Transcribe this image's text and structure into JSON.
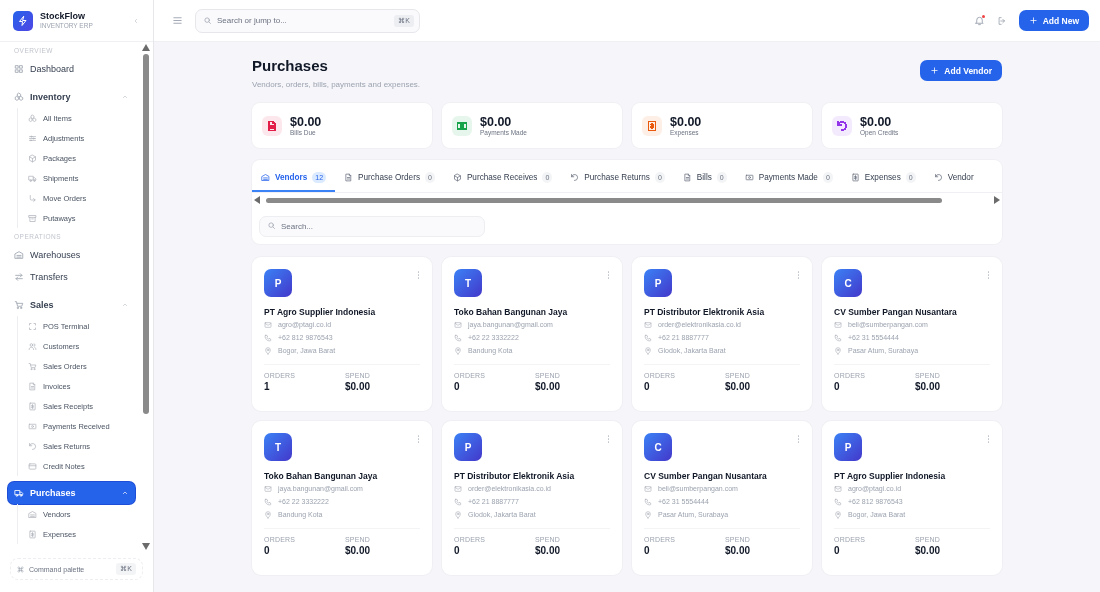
{
  "app": {
    "name": "StockFlow",
    "subtitle": "INVENTORY ERP"
  },
  "sidebar": {
    "sections": [
      {
        "label": "OVERVIEW",
        "items": [
          {
            "label": "Dashboard",
            "selected": false
          },
          {
            "label": "Inventory",
            "selected": false,
            "expanded": true,
            "children": [
              {
                "label": "All Items",
                "selected": false
              },
              {
                "label": "Adjustments",
                "selected": false
              },
              {
                "label": "Packages",
                "selected": false
              },
              {
                "label": "Shipments",
                "selected": false
              },
              {
                "label": "Move Orders",
                "selected": false
              },
              {
                "label": "Putaways",
                "selected": false
              }
            ]
          }
        ]
      },
      {
        "label": "OPERATIONS",
        "items": [
          {
            "label": "Warehouses",
            "selected": false
          },
          {
            "label": "Transfers",
            "selected": false
          },
          {
            "label": "Sales",
            "selected": false,
            "expanded": true,
            "children": [
              {
                "label": "POS Terminal",
                "selected": false
              },
              {
                "label": "Customers",
                "selected": false
              },
              {
                "label": "Sales Orders",
                "selected": false
              },
              {
                "label": "Invoices",
                "selected": false
              },
              {
                "label": "Sales Receipts",
                "selected": false
              },
              {
                "label": "Payments Received",
                "selected": false
              },
              {
                "label": "Sales Returns",
                "selected": false
              },
              {
                "label": "Credit Notes",
                "selected": false
              }
            ]
          },
          {
            "label": "Purchases",
            "selected": true,
            "expanded": true,
            "children": [
              {
                "label": "Vendors",
                "selected": false
              },
              {
                "label": "Expenses",
                "selected": false
              }
            ]
          }
        ]
      }
    ],
    "command_palette": {
      "label": "Command palette",
      "shortcut": "⌘K"
    }
  },
  "topbar": {
    "search": {
      "placeholder": "Search or jump to...",
      "shortcut": "⌘K"
    },
    "notifications": {
      "unread": true
    },
    "add_button": "Add New"
  },
  "page": {
    "title": "Purchases",
    "subtitle": "Vendors, orders, bills, payments and expenses.",
    "action": "Add Vendor"
  },
  "stats": [
    {
      "value": "$0.00",
      "label": "Bills Due",
      "color": "#e11d48"
    },
    {
      "value": "$0.00",
      "label": "Payments Made",
      "color": "#16a34a"
    },
    {
      "value": "$0.00",
      "label": "Expenses",
      "color": "#ea580c"
    },
    {
      "value": "$0.00",
      "label": "Open Credits",
      "color": "#9333ea"
    }
  ],
  "tabs": [
    {
      "label": "Vendors",
      "count": "12",
      "selected": true
    },
    {
      "label": "Purchase Orders",
      "count": "0",
      "selected": false
    },
    {
      "label": "Purchase Receives",
      "count": "0",
      "selected": false
    },
    {
      "label": "Purchase Returns",
      "count": "0",
      "selected": false
    },
    {
      "label": "Bills",
      "count": "0",
      "selected": false
    },
    {
      "label": "Payments Made",
      "count": "0",
      "selected": false
    },
    {
      "label": "Expenses",
      "count": "0",
      "selected": false
    },
    {
      "label": "Vendor",
      "selected": false
    }
  ],
  "vendor_search": {
    "placeholder": "Search..."
  },
  "vendors": [
    {
      "initial": "P",
      "name": "PT Agro Supplier Indonesia",
      "email": "agro@ptagi.co.id",
      "phone": "+62 812 9876543",
      "location": "Bogor, Jawa Barat",
      "stats": [
        {
          "label": "ORDERS",
          "value": "1"
        },
        {
          "label": "SPEND",
          "value": "$0.00"
        }
      ]
    },
    {
      "initial": "T",
      "name": "Toko Bahan Bangunan Jaya",
      "email": "jaya.bangunan@gmail.com",
      "phone": "+62 22 3332222",
      "location": "Bandung Kota",
      "stats": [
        {
          "label": "ORDERS",
          "value": "0"
        },
        {
          "label": "SPEND",
          "value": "$0.00"
        }
      ]
    },
    {
      "initial": "P",
      "name": "PT Distributor Elektronik Asia",
      "email": "order@elektronikasia.co.id",
      "phone": "+62 21 8887777",
      "location": "Glodok, Jakarta Barat",
      "stats": [
        {
          "label": "ORDERS",
          "value": "0"
        },
        {
          "label": "SPEND",
          "value": "$0.00"
        }
      ]
    },
    {
      "initial": "C",
      "name": "CV Sumber Pangan Nusantara",
      "email": "beli@sumberpangan.com",
      "phone": "+62 31 5554444",
      "location": "Pasar Atum, Surabaya",
      "stats": [
        {
          "label": "ORDERS",
          "value": "0"
        },
        {
          "label": "SPEND",
          "value": "$0.00"
        }
      ]
    },
    {
      "initial": "T",
      "name": "Toko Bahan Bangunan Jaya",
      "email": "jaya.bangunan@gmail.com",
      "phone": "+62 22 3332222",
      "location": "Bandung Kota",
      "stats": [
        {
          "label": "ORDERS",
          "value": "0"
        },
        {
          "label": "SPEND",
          "value": "$0.00"
        }
      ]
    },
    {
      "initial": "P",
      "name": "PT Distributor Elektronik Asia",
      "email": "order@elektronikasia.co.id",
      "phone": "+62 21 8887777",
      "location": "Glodok, Jakarta Barat",
      "stats": [
        {
          "label": "ORDERS",
          "value": "0"
        },
        {
          "label": "SPEND",
          "value": "$0.00"
        }
      ]
    },
    {
      "initial": "C",
      "name": "CV Sumber Pangan Nusantara",
      "email": "beli@sumberpangan.com",
      "phone": "+62 31 5554444",
      "location": "Pasar Atum, Surabaya",
      "stats": [
        {
          "label": "ORDERS",
          "value": "0"
        },
        {
          "label": "SPEND",
          "value": "$0.00"
        }
      ]
    },
    {
      "initial": "P",
      "name": "PT Agro Supplier Indonesia",
      "email": "agro@ptagi.co.id",
      "phone": "+62 812 9876543",
      "location": "Bogor, Jawa Barat",
      "stats": [
        {
          "label": "ORDERS",
          "value": "0"
        },
        {
          "label": "SPEND",
          "value": "$0.00"
        }
      ]
    }
  ]
}
